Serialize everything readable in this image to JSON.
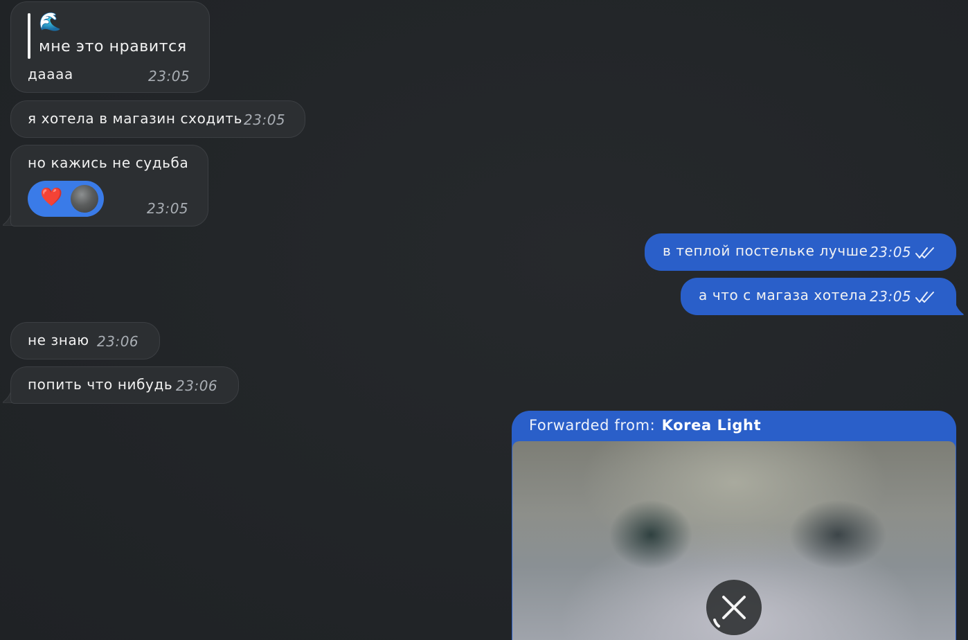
{
  "messages": {
    "m1": {
      "reply_icon": "wave-emoji",
      "reply_emoji": "🌊",
      "reply_text": "мне это нравится",
      "text": "даааа",
      "time": "23:05"
    },
    "m2": {
      "text": "я хотела в магазин сходить",
      "time": "23:05"
    },
    "m3": {
      "text": "но кажись не судьба",
      "time": "23:05",
      "reaction": {
        "emoji": "❤️",
        "icon": "heart-icon"
      }
    },
    "m4": {
      "text": "в теплой постельке лучше",
      "time": "23:05",
      "status_icon": "double-check-icon"
    },
    "m5": {
      "text": "а что с магаза хотела",
      "time": "23:05",
      "status_icon": "double-check-icon"
    },
    "m6": {
      "text": "не знаю",
      "time": "23:06"
    },
    "m7": {
      "text": "попить что нибудь",
      "time": "23:06"
    },
    "m8": {
      "forward_label": "Forwarded from:",
      "forward_source": "Korea Light",
      "media_icon": "close-icon"
    }
  },
  "colors": {
    "background": "#222528",
    "incoming_bubble": "#2c2f32",
    "outgoing_bubble": "#2a5fc9",
    "time_incoming": "#a9aeb4",
    "reaction_pill": "#3a7be8"
  }
}
